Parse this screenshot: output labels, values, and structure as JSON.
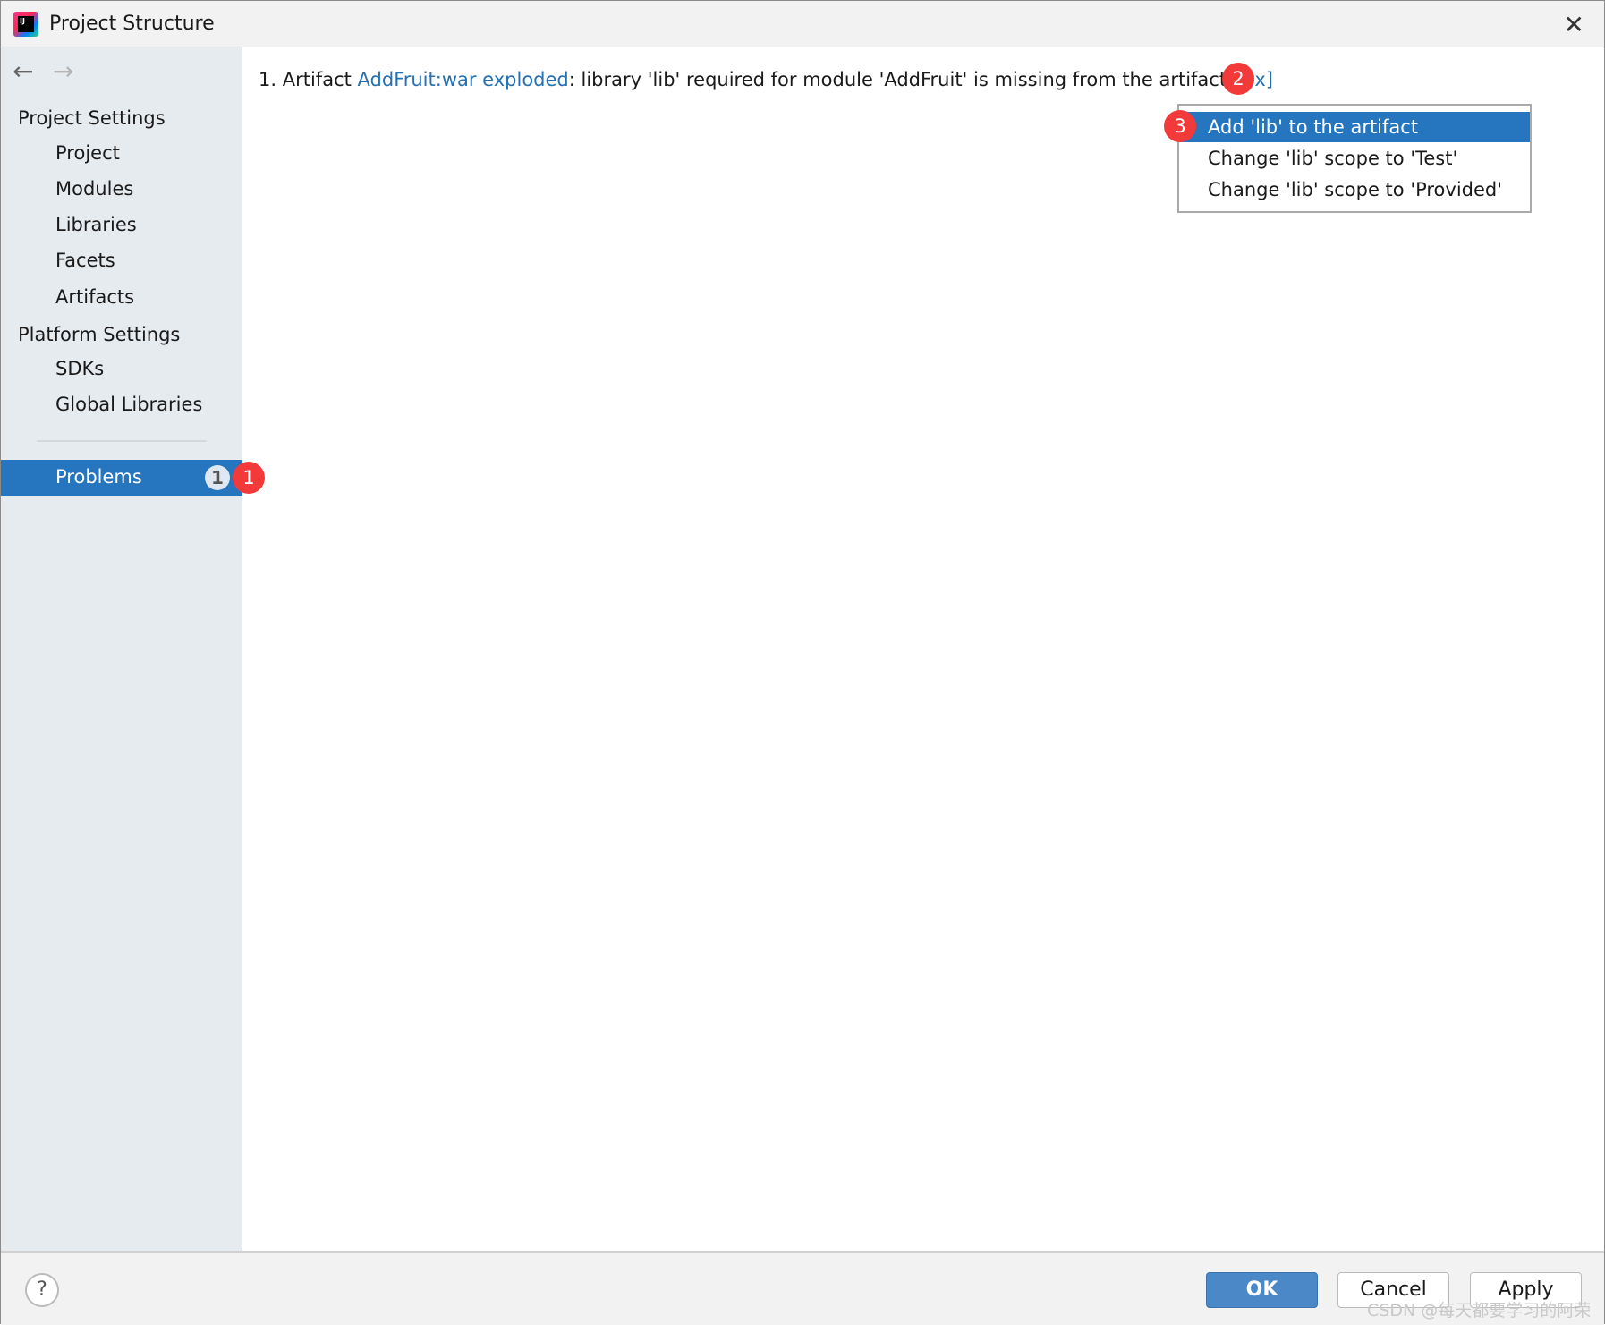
{
  "window": {
    "title": "Project Structure",
    "close_icon": "close-icon"
  },
  "sidebar": {
    "project_settings": "Project Settings",
    "project_items": [
      "Project",
      "Modules",
      "Libraries",
      "Facets",
      "Artifacts"
    ],
    "platform_settings": "Platform Settings",
    "platform_items": [
      "SDKs",
      "Global Libraries"
    ],
    "problems": {
      "label": "Problems",
      "count": "1"
    }
  },
  "main": {
    "problem": {
      "index": "1.",
      "prefix": "Artifact",
      "artifact_link": "AddFruit:war exploded",
      "message": ": library 'lib' required for module 'AddFruit' is missing from the artifact",
      "fix_link": "[Fix]"
    },
    "fix_menu": [
      "Add 'lib' to the artifact",
      "Change 'lib' scope to 'Test'",
      "Change 'lib' scope to 'Provided'"
    ],
    "selected_fix": "Add 'lib' to the artifact"
  },
  "annotations": [
    "1",
    "2",
    "3"
  ],
  "footer": {
    "help": "?",
    "ok": "OK",
    "cancel": "Cancel",
    "apply": "Apply",
    "watermark": "CSDN @每天都要学习的阿荣"
  },
  "colors": {
    "accent": "#2675bf",
    "link": "#2470b3",
    "annotation": "#f33a3a"
  }
}
